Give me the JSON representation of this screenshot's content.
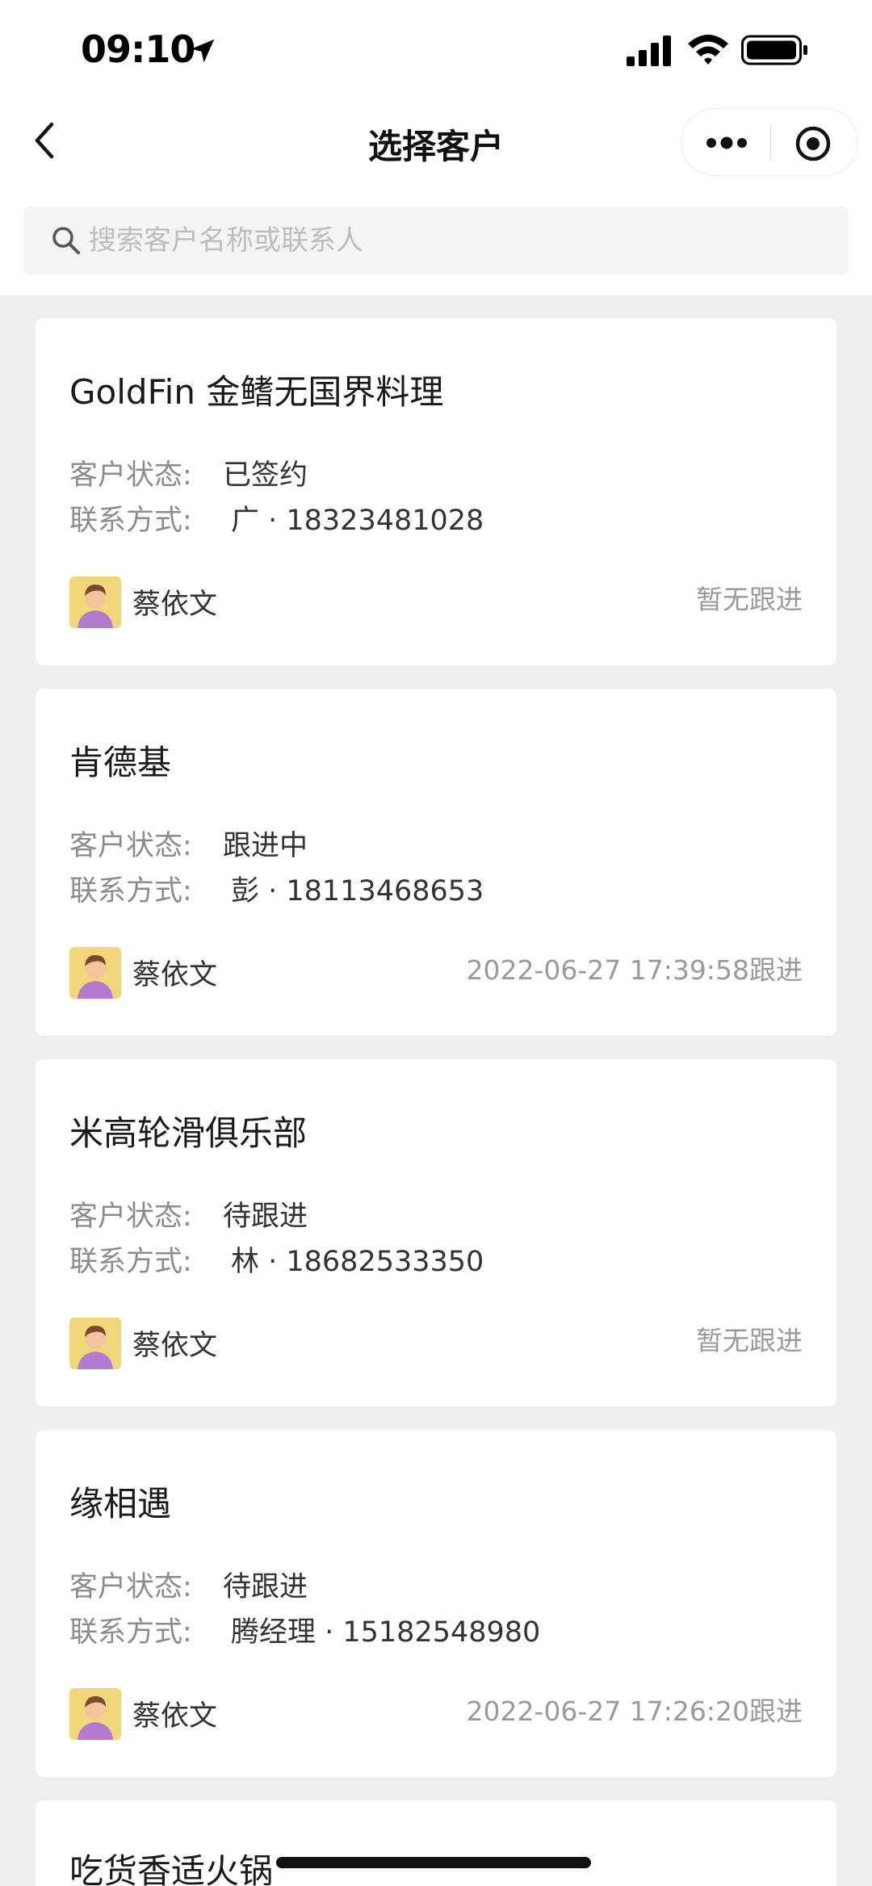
{
  "status_bar": {
    "time": "09:10"
  },
  "nav": {
    "title": "选择客户"
  },
  "search": {
    "placeholder": "搜索客户名称或联系人"
  },
  "labels": {
    "status": "客户状态:",
    "contact": "联系方式:"
  },
  "customers": [
    {
      "name": "GoldFin 金鳍无国界料理",
      "status": "已签约",
      "contact": "广 · 18323481028",
      "owner": "蔡依文",
      "followup": "暂无跟进"
    },
    {
      "name": "肯德基",
      "status": "跟进中",
      "contact": "彭 · 18113468653",
      "owner": "蔡依文",
      "followup": "2022-06-27 17:39:58跟进"
    },
    {
      "name": "米高轮滑俱乐部",
      "status": "待跟进",
      "contact": "林 · 18682533350",
      "owner": "蔡依文",
      "followup": "暂无跟进"
    },
    {
      "name": "缘相遇",
      "status": "待跟进",
      "contact": "腾经理 · 15182548980",
      "owner": "蔡依文",
      "followup": "2022-06-27 17:26:20跟进"
    },
    {
      "name": "吃货香适火锅"
    }
  ]
}
